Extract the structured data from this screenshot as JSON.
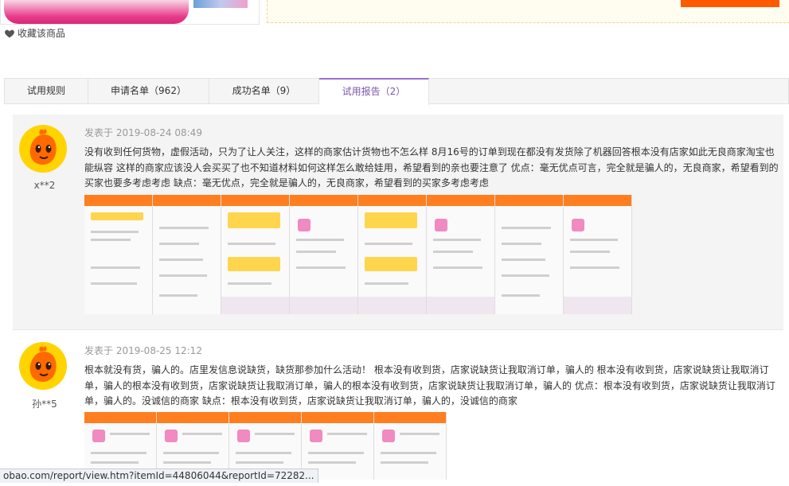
{
  "product": {
    "favorite_label": "收藏该商品"
  },
  "tabs": [
    {
      "label": "试用规则"
    },
    {
      "label": "申请名单（962）"
    },
    {
      "label": "成功名单（9）"
    },
    {
      "label": "试用报告（2）",
      "active": true
    }
  ],
  "reports": [
    {
      "username": "x**2",
      "date": "发表于 2019-08-24 08:49",
      "content": "没有收到任何货物，虚假活动，只为了让人关注，这样的商家估计货物也不怎么样 8月16号的订单到现在都没有发货除了机器回答根本没有店家如此无良商家淘宝也能纵容 这样的商家应该没人会买买了也不知道材料如何这样怎么敢给娃用，希望看到的亲也要注意了 优点：毫无优点可言，完全就是骗人的，无良商家，希望看到的买家也要多考虑考虑 缺点：毫无优点，完全就是骗人的，无良商家，希望看到的买家多考虑考虑",
      "screenshots": 8
    },
    {
      "username": "孙**5",
      "date": "发表于 2019-08-25 12:12",
      "content": "根本就没有货，骗人的。店里发信息说缺货，缺货那参加什么活动！ 根本没有收到货，店家说缺货让我取消订单，骗人的 根本没有收到货，店家说缺货让我取消订单，骗人的根本没有收到货，店家说缺货让我取消订单，骗人的根本没有收到货，店家说缺货让我取消订单，骗人的 优点：根本没有收到货，店家说缺货让我取消订单，骗人的。没诚信的商家 缺点：根本没有收到货，店家说缺货让我取消订单，骗人的，没诚信的商家",
      "screenshots": 5
    }
  ],
  "status_bar": {
    "url": "obao.com/report/view.htm?itemId=44806044&reportId=72282..."
  },
  "colors": {
    "accent": "#9a6fd0",
    "active_tab_text": "#7b56a8",
    "brand_orange": "#ff5a00"
  },
  "icons": {
    "favorite": "heart-icon",
    "avatar": "taobao-mascot-avatar"
  }
}
